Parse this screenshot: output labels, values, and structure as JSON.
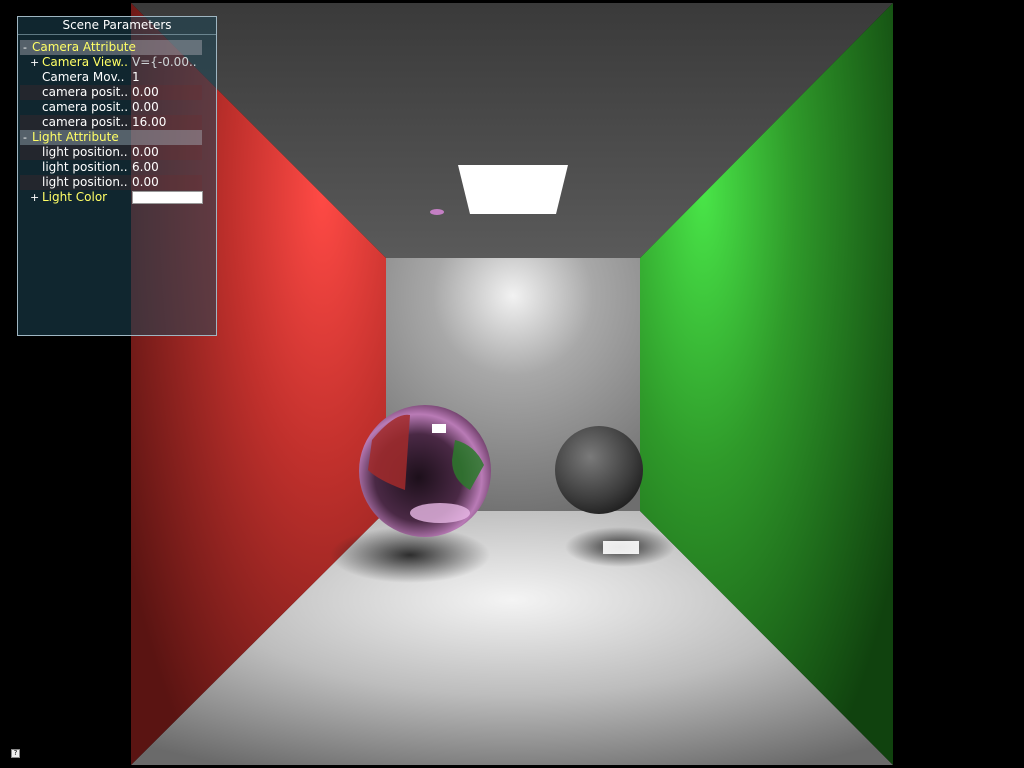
{
  "panel": {
    "title": "Scene Parameters",
    "groups": [
      {
        "toggle": "-",
        "label": "Camera Attribute",
        "items": [
          {
            "toggle": "+",
            "label": "Camera View..",
            "value": "V={-0.00..",
            "expandable": true
          },
          {
            "label": "Camera Mov..",
            "value": "1"
          },
          {
            "label": "camera posit..",
            "value": "0.00"
          },
          {
            "label": "camera posit..",
            "value": "0.00"
          },
          {
            "label": "camera posit..",
            "value": "16.00"
          }
        ]
      },
      {
        "toggle": "-",
        "label": "Light Attribute",
        "items": [
          {
            "label": "light position..",
            "value": "0.00"
          },
          {
            "label": "light position..",
            "value": "6.00"
          },
          {
            "label": "light position..",
            "value": "0.00"
          },
          {
            "toggle": "+",
            "label": "Light Color",
            "swatch_color": "#ffffff",
            "expandable": true
          }
        ]
      }
    ]
  },
  "scene": {
    "left_wall_color": "#c0302c",
    "right_wall_color": "#2f9a2a",
    "light_color": "#ffffff"
  },
  "corner_icon": "help-icon"
}
